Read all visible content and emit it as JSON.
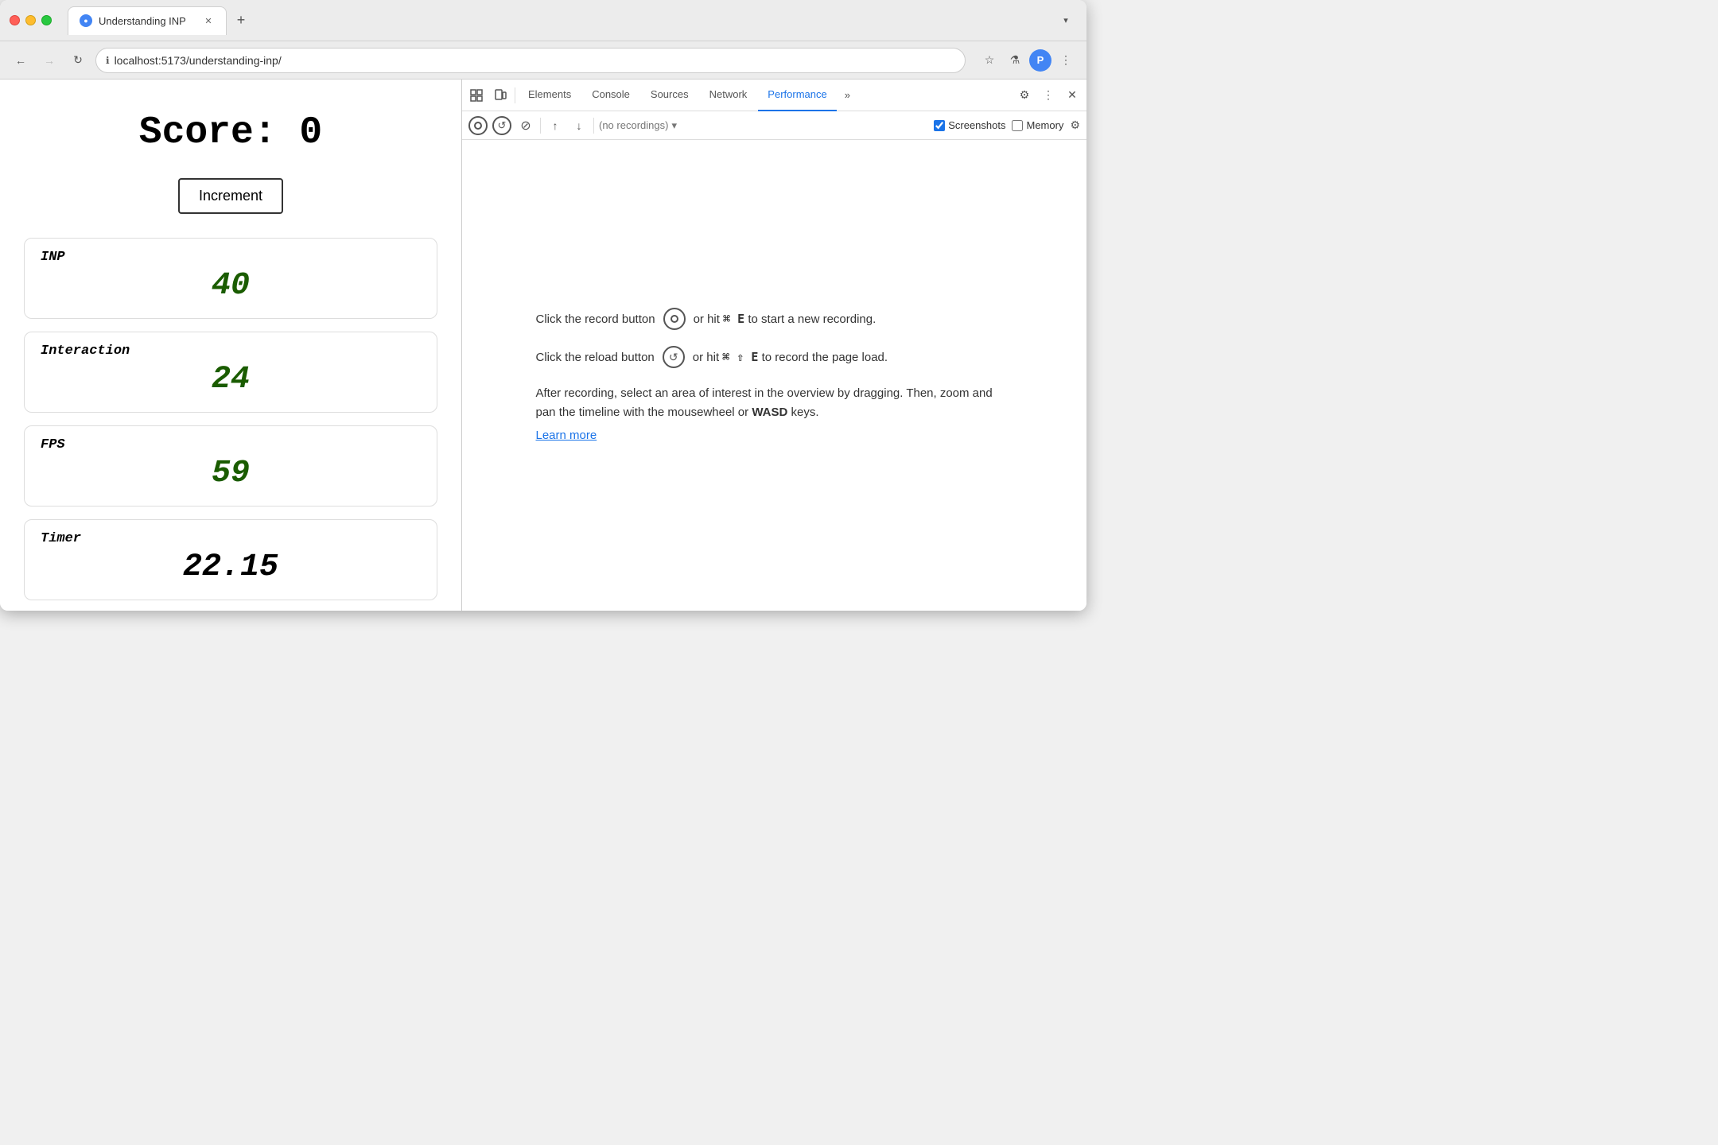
{
  "browser": {
    "tab_title": "Understanding INP",
    "tab_favicon": "globe",
    "url": "localhost:5173/understanding-inp/",
    "nav": {
      "back_disabled": false,
      "forward_disabled": true
    }
  },
  "webpage": {
    "score_label": "Score:",
    "score_value": "0",
    "increment_button": "Increment",
    "metrics": [
      {
        "id": "inp",
        "label": "INP",
        "value": "40",
        "is_timer": false
      },
      {
        "id": "interaction",
        "label": "Interaction",
        "value": "24",
        "is_timer": false
      },
      {
        "id": "fps",
        "label": "FPS",
        "value": "59",
        "is_timer": false
      },
      {
        "id": "timer",
        "label": "Timer",
        "value": "22.15",
        "is_timer": true
      }
    ]
  },
  "devtools": {
    "panels": [
      {
        "id": "elements",
        "label": "Elements",
        "active": false
      },
      {
        "id": "console",
        "label": "Console",
        "active": false
      },
      {
        "id": "sources",
        "label": "Sources",
        "active": false
      },
      {
        "id": "network",
        "label": "Network",
        "active": false
      },
      {
        "id": "performance",
        "label": "Performance",
        "active": true
      }
    ],
    "overflow_label": "»",
    "toolbar": {
      "recordings_placeholder": "(no recordings)",
      "screenshots_label": "Screenshots",
      "screenshots_checked": true,
      "memory_label": "Memory",
      "memory_checked": false
    },
    "instructions": {
      "record_text_before": "Click the record button",
      "record_text_after": "or hit",
      "record_shortcut": "⌘ E",
      "record_suffix": "to start a new recording.",
      "reload_text_before": "Click the reload button",
      "reload_text_after": "or hit",
      "reload_shortcut": "⌘ ⇧ E",
      "reload_suffix": "to record the page load.",
      "extra_text": "After recording, select an area of interest in the overview by dragging. Then, zoom and pan the timeline with the mousewheel or",
      "extra_bold": "WASD",
      "extra_suffix": "keys.",
      "learn_more": "Learn more"
    }
  }
}
